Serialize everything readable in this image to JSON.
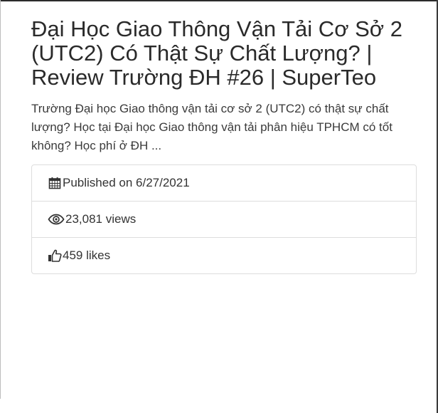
{
  "video": {
    "title": "Đại Học Giao Thông Vận Tải Cơ Sở 2 (UTC2) Có Thật Sự Chất Lượng? | Review Trường ĐH #26 | SuperTeo",
    "description": "Trường Đại học Giao thông vận tải cơ sở 2 (UTC2) có thật sự chất lượng? Học tại Đại học Giao thông vận tải phân hiệu TPHCM có tốt không? Học phí ở ĐH ..."
  },
  "stats": [
    {
      "icon": "calendar-icon",
      "text": "Published on 6/27/2021"
    },
    {
      "icon": "eye-icon",
      "text": "23,081 views"
    },
    {
      "icon": "thumbs-up-icon",
      "text": "459 likes"
    }
  ]
}
